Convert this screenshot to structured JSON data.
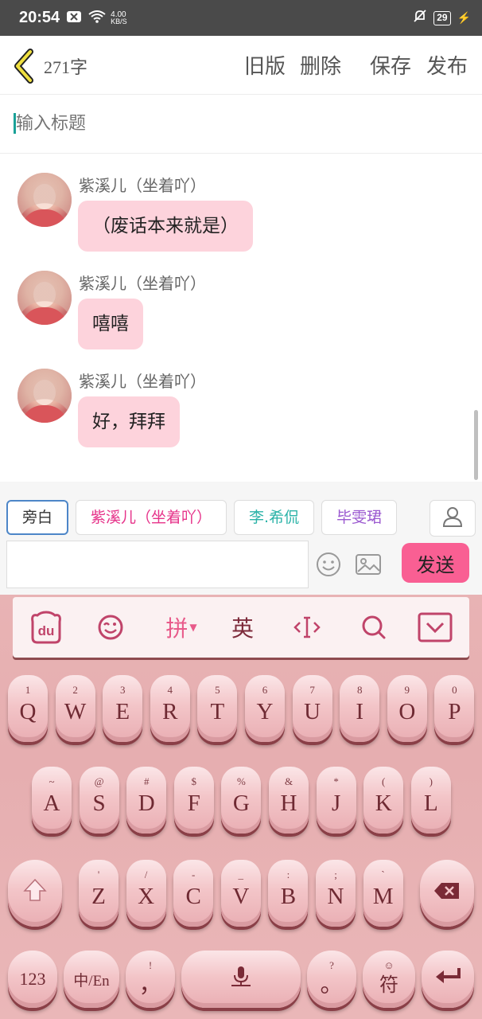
{
  "status_bar": {
    "time": "20:54",
    "net_speed_top": "4.00",
    "net_speed_bottom": "KB/S",
    "battery": "29"
  },
  "header": {
    "char_count": "271字",
    "old_version": "旧版",
    "delete": "删除",
    "save": "保存",
    "publish": "发布"
  },
  "title_input": {
    "placeholder": "输入标题"
  },
  "messages": [
    {
      "sender": "紫溪儿（坐着吖）",
      "text": "（废话本来就是）"
    },
    {
      "sender": "紫溪儿（坐着吖）",
      "text": "嘻嘻"
    },
    {
      "sender": "紫溪儿（坐着吖）",
      "text": "好，拜拜"
    }
  ],
  "roles": [
    {
      "label": "旁白",
      "color": "#333333"
    },
    {
      "label": "紫溪儿（坐着吖）",
      "color": "#e6338a"
    },
    {
      "label": "李.希侃",
      "color": "#2bb3a8"
    },
    {
      "label": "毕雯珺",
      "color": "#9b59d0"
    }
  ],
  "composer": {
    "send": "发送"
  },
  "keyboard": {
    "toolbar": {
      "pinyin": "拼",
      "english": "英"
    },
    "row1": [
      [
        "1",
        "Q"
      ],
      [
        "2",
        "W"
      ],
      [
        "3",
        "E"
      ],
      [
        "4",
        "R"
      ],
      [
        "5",
        "T"
      ],
      [
        "6",
        "Y"
      ],
      [
        "7",
        "U"
      ],
      [
        "8",
        "I"
      ],
      [
        "9",
        "O"
      ],
      [
        "0",
        "P"
      ]
    ],
    "row2": [
      [
        "~",
        "A"
      ],
      [
        "@",
        "S"
      ],
      [
        "#",
        "D"
      ],
      [
        "$",
        "F"
      ],
      [
        "%",
        "G"
      ],
      [
        "&",
        "H"
      ],
      [
        "*",
        "J"
      ],
      [
        "(",
        "K"
      ],
      [
        ")",
        "L"
      ]
    ],
    "row3": [
      [
        "'",
        "Z"
      ],
      [
        "/",
        "X"
      ],
      [
        "-",
        "C"
      ],
      [
        "_",
        "V"
      ],
      [
        ":",
        "B"
      ],
      [
        ";",
        "N"
      ],
      [
        "`",
        "M"
      ]
    ],
    "num_key": "123",
    "lang_key": "中/En",
    "comma_top": "!",
    "comma": "，",
    "period_top": "?",
    "period": "。",
    "symbol_key": "符"
  },
  "colors": {
    "accent": "#f95f93",
    "bubble": "#fdd3dc",
    "caret": "#1aa197",
    "key_text": "#6f2a33"
  }
}
